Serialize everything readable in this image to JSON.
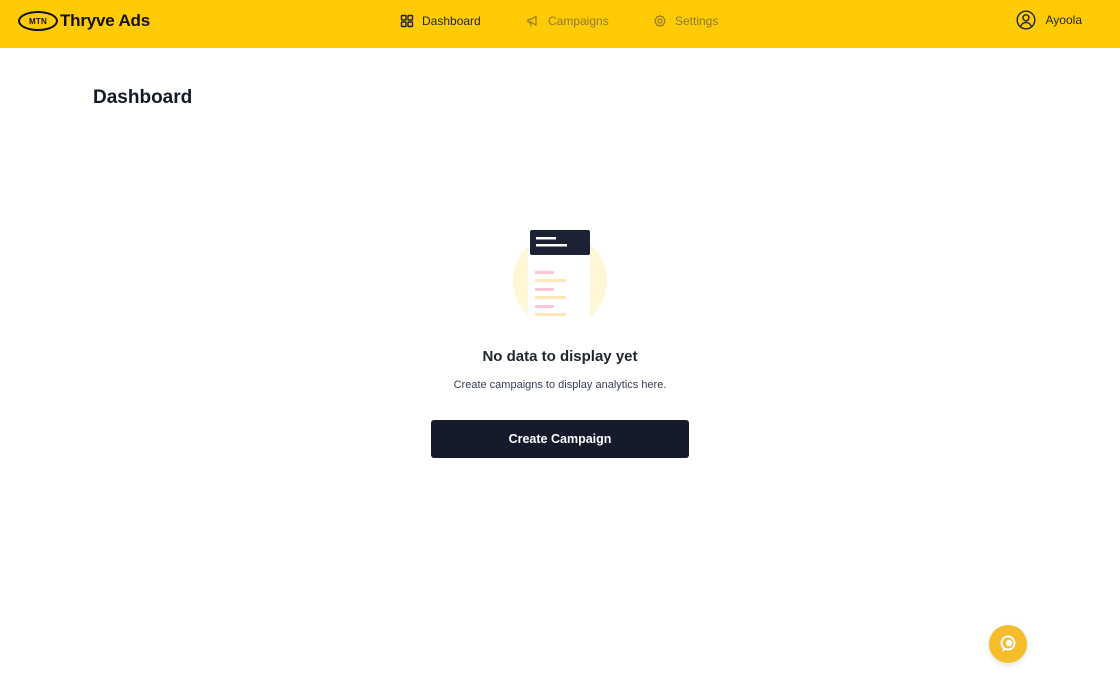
{
  "brand": {
    "badge": "MTN",
    "name": "Thryve Ads"
  },
  "nav": {
    "items": [
      {
        "label": "Dashboard",
        "icon": "grid-icon",
        "active": true
      },
      {
        "label": "Campaigns",
        "icon": "megaphone-icon",
        "active": false
      },
      {
        "label": "Settings",
        "icon": "gear-icon",
        "active": false
      }
    ]
  },
  "user": {
    "name": "Ayoola",
    "icon": "user-circle-icon"
  },
  "page": {
    "title": "Dashboard"
  },
  "empty_state": {
    "title": "No data to display yet",
    "subtitle": "Create campaigns to display analytics here.",
    "button_label": "Create Campaign"
  },
  "colors": {
    "topbar": "#ffcb05",
    "button": "#151b2b",
    "fab": "#f6bd2b"
  }
}
